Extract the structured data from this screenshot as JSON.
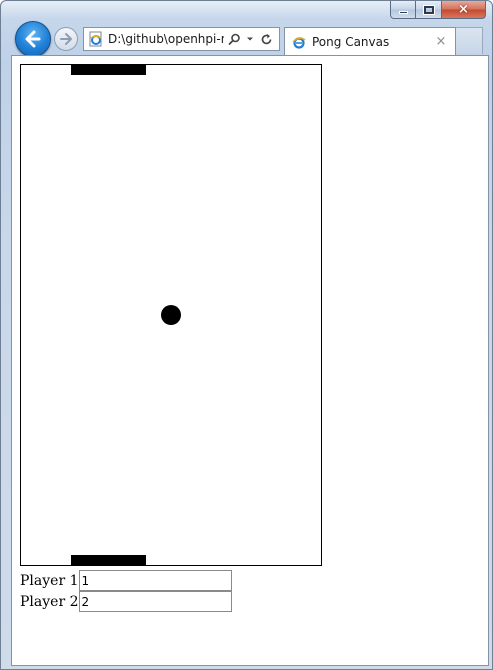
{
  "window": {
    "minimize_label": "",
    "maximize_label": "",
    "close_label": "×"
  },
  "navigation": {
    "address": "D:\\github\\openhpi-m",
    "tab_title": "Pong Canvas",
    "tab_close": "×"
  },
  "game": {
    "ball_color": "#000000",
    "paddle_color": "#000000"
  },
  "scores": {
    "player1_label": "Player 1",
    "player1_value": "1",
    "player2_label": "Player 2",
    "player2_value": "2"
  },
  "colors": {
    "back_button": "#1f7fd6",
    "close_button": "#c24a2f"
  }
}
